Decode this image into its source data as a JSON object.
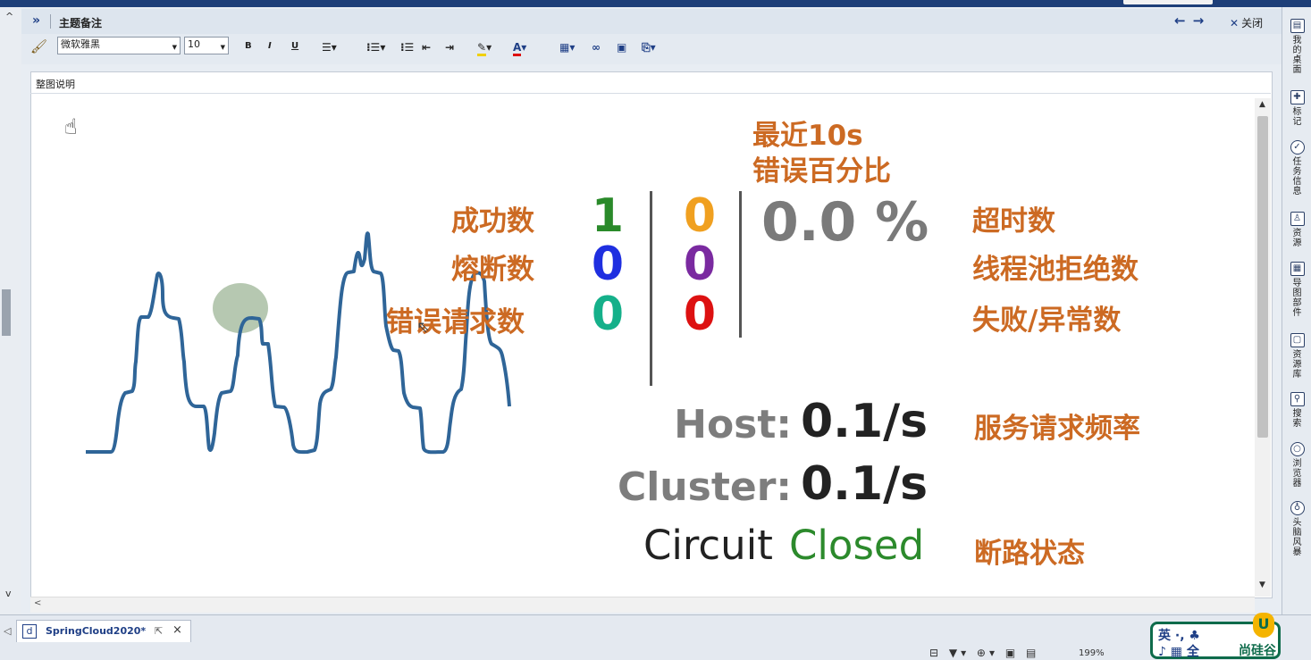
{
  "window": {
    "panel_title": "主题备注",
    "close_label": "关闭"
  },
  "toolbar": {
    "font_name": "微软雅黑",
    "font_size": "10",
    "bold": "B",
    "italic": "I",
    "underline": "U"
  },
  "document": {
    "label": "整图说明"
  },
  "diagram": {
    "recent_error_label_1": "最近10s",
    "recent_error_label_2": "错误百分比",
    "left_labels": [
      "成功数",
      "熔断数",
      "错误请求数"
    ],
    "col1_values": [
      "1",
      "0",
      "0"
    ],
    "col2_values": [
      "0",
      "0",
      "0"
    ],
    "right_labels": [
      "超时数",
      "线程池拒绝数",
      "失败/异常数"
    ],
    "error_percent": "0.0 %",
    "host_label": "Host:",
    "host_rate": "0.1/s",
    "cluster_label": "Cluster:",
    "cluster_rate": "0.1/s",
    "rate_desc": "服务请求频率",
    "circuit_label": "Circuit",
    "circuit_state": "Closed",
    "circuit_desc": "断路状态",
    "colors": {
      "label_orange": "#cc6a23",
      "green": "#2a8a2a",
      "orange": "#f0a020",
      "blue": "#1f2fe0",
      "purple": "#7a2aa0",
      "teal": "#15b08a",
      "red": "#dd1111",
      "line": "#2f6598"
    }
  },
  "right_sidebar": {
    "items": [
      "我的桌面",
      "标记",
      "任务信息",
      "资源",
      "导图部件",
      "资源库",
      "搜索",
      "浏览器",
      "头脑风暴"
    ]
  },
  "status": {
    "doc_tab": "SpringCloud2020*",
    "zoom": "199%",
    "ime_line1": "英 ·, ♣",
    "ime_line2": "♪ ▦ 全",
    "brand": "尚硅谷"
  }
}
